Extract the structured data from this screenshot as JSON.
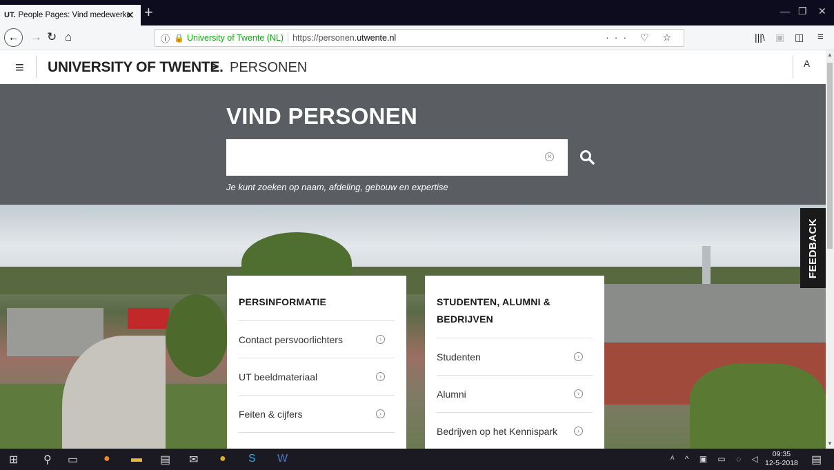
{
  "browser": {
    "tab_favicon_text": "UT.",
    "tab_title": "People Pages: Vind medewerke",
    "tab_close": "✕",
    "new_tab": "+",
    "identity": "University of Twente (NL)",
    "url_prefix": "https://personen.",
    "url_domain": "utwente.nl",
    "url_actions": "··· ♡ ☆"
  },
  "header": {
    "logo": "UNIVERSITY OF TWENTE.",
    "separator": ">",
    "breadcrumb": "PERSONEN"
  },
  "search": {
    "heading": "VIND PERSONEN",
    "value": "",
    "placeholder": "",
    "hint": "Je kunt zoeken op naam, afdeling, gebouw en expertise"
  },
  "feedback_label": "FEEDBACK",
  "cards": [
    {
      "title": "PERSINFORMATIE",
      "items": [
        "Contact persvoorlichters",
        "UT beeldmateriaal",
        "Feiten & cijfers"
      ]
    },
    {
      "title": "STUDENTEN, ALUMNI & BEDRIJVEN",
      "items": [
        "Studenten",
        "Alumni",
        "Bedrijven op het Kennispark"
      ]
    }
  ],
  "taskbar": {
    "time": "09:35",
    "date": "12-5-2018"
  },
  "colors": {
    "search_band": "#5a5e62",
    "secure_green": "#12a812",
    "taskbar": "#1b1a22"
  }
}
